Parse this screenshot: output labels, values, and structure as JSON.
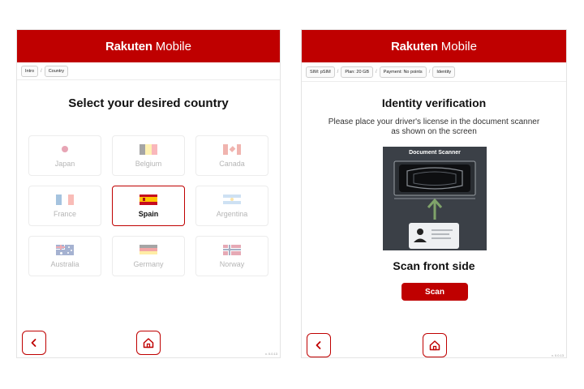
{
  "left_screen": {
    "header": {
      "logo_brand": "Rakuten",
      "logo_sub": "Mobile"
    },
    "breadcrumb": {
      "items": [
        "Intro",
        "Country"
      ],
      "separator": "/"
    },
    "title": "Select your desired country",
    "countries": [
      {
        "name": "Japan",
        "flag_icon": "japan-flag-icon",
        "selected": false
      },
      {
        "name": "Belgium",
        "flag_icon": "belgium-flag-icon",
        "selected": false
      },
      {
        "name": "Canada",
        "flag_icon": "canada-flag-icon",
        "selected": false
      },
      {
        "name": "France",
        "flag_icon": "france-flag-icon",
        "selected": false
      },
      {
        "name": "Spain",
        "flag_icon": "spain-flag-icon",
        "selected": true
      },
      {
        "name": "Argentina",
        "flag_icon": "argentina-flag-icon",
        "selected": false
      },
      {
        "name": "Australia",
        "flag_icon": "australia-flag-icon",
        "selected": false
      },
      {
        "name": "Germany",
        "flag_icon": "germany-flag-icon",
        "selected": false
      },
      {
        "name": "Norway",
        "flag_icon": "norway-flag-icon",
        "selected": false
      }
    ],
    "nav": {
      "back_icon": "chevron-left-icon",
      "home_icon": "home-icon"
    },
    "version": "v. 0.0.13"
  },
  "right_screen": {
    "header": {
      "logo_brand": "Rakuten",
      "logo_sub": "Mobile"
    },
    "breadcrumb": {
      "items": [
        "SIM: pSIM",
        "Plan: 20 GB",
        "Payment: No points",
        "Identity"
      ],
      "separator": "/"
    },
    "title": "Identity verification",
    "instruction": "Please place your driver's license in the document scanner as shown on the screen",
    "scanner_label": "Document Scanner",
    "scan_side": "Scan front side",
    "scan_button": "Scan",
    "nav": {
      "back_icon": "chevron-left-icon",
      "home_icon": "home-icon"
    },
    "version": "v. 0.0.13"
  },
  "colors": {
    "brand_red": "#bf0000",
    "muted_text": "#b5b5b5",
    "scanner_bg": "#3b4047"
  }
}
